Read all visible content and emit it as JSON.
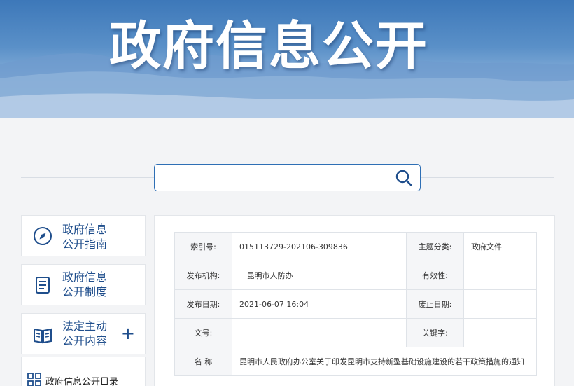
{
  "banner": {
    "title": "政府信息公开"
  },
  "search": {
    "placeholder": "",
    "value": ""
  },
  "sidebar": {
    "items": [
      {
        "label": "政府信息\n公开指南",
        "icon": "compass-icon"
      },
      {
        "label": "政府信息\n公开制度",
        "icon": "document-icon"
      },
      {
        "label": "法定主动\n公开内容",
        "icon": "book-icon",
        "expand": "+"
      }
    ],
    "catalog": {
      "label": "政府信息公开目录",
      "icon": "grid-icon"
    }
  },
  "meta": {
    "rows": [
      {
        "k1": "索引号:",
        "v1": "015113729-202106-309836",
        "k2": "主题分类:",
        "v2": "政府文件"
      },
      {
        "k1": "发布机构:",
        "v1": "   昆明市人防办",
        "k2": "有效性:",
        "v2": ""
      },
      {
        "k1": "发布日期:",
        "v1": "2021-06-07 16:04",
        "k2": "废止日期:",
        "v2": ""
      },
      {
        "k1": "文号:",
        "v1": "",
        "k2": "关键字:",
        "v2": ""
      }
    ],
    "name_label": "名 称",
    "name_value": "昆明市人民政府办公室关于印发昆明市支持新型基础设施建设的若干政策措施的通知"
  },
  "colors": {
    "accent": "#1f4e8c",
    "search_border": "#2e6fb5"
  }
}
